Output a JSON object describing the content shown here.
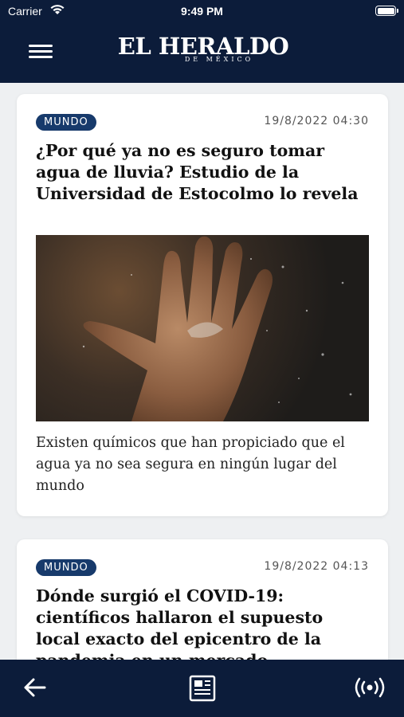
{
  "status_bar": {
    "carrier": "Carrier",
    "time": "9:49 PM"
  },
  "header": {
    "logo_main": "EL HERALDO",
    "logo_sub": "DE MÉXICO"
  },
  "articles": [
    {
      "section": "MUNDO",
      "date": "19/8/2022 04:30",
      "headline": "¿Por qué ya no es seguro tomar agua de lluvia? Estudio de la Universidad de Estocolmo lo revela",
      "summary": "Existen químicos que han propiciado que el agua ya no sea segura en ningún lugar del mundo"
    },
    {
      "section": "MUNDO",
      "date": "19/8/2022 04:13",
      "headline": "Dónde surgió el COVID-19: científicos hallaron el supuesto local exacto del epicentro de la pandemia en un mercado"
    }
  ],
  "bottom_nav": {
    "items": [
      "back-arrow-icon",
      "newspaper-icon",
      "live-broadcast-icon"
    ]
  },
  "colors": {
    "navy": "#0c1c3a",
    "tag": "#173a6b",
    "background": "#eef0f2"
  }
}
